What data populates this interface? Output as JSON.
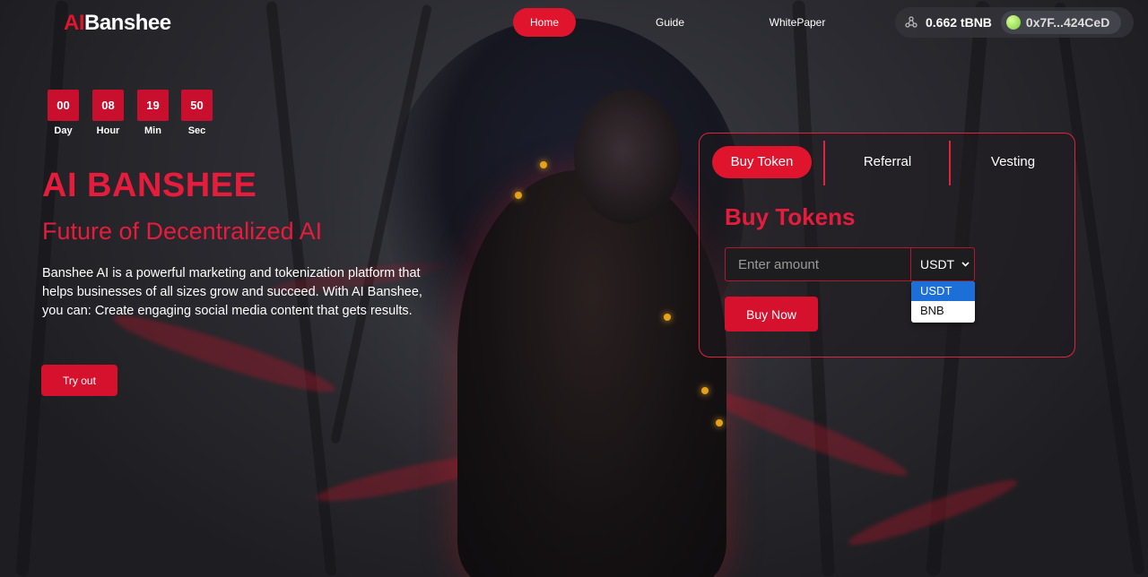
{
  "header": {
    "logo_ai": "AI",
    "logo_rest": "Banshee",
    "nav": {
      "home": "Home",
      "guide": "Guide",
      "whitepaper": "WhitePaper"
    },
    "wallet": {
      "network_icon": "network-icon",
      "balance": "0.662 tBNB",
      "address": "0x7F...424CeD"
    }
  },
  "countdown": {
    "day_value": "00",
    "day_label": "Day",
    "hour_value": "08",
    "hour_label": "Hour",
    "min_value": "19",
    "min_label": "Min",
    "sec_value": "50",
    "sec_label": "Sec"
  },
  "hero": {
    "title": "AI BANSHEE",
    "subtitle": "Future of Decentralized AI",
    "description": "Banshee AI is a powerful marketing and tokenization platform that helps businesses of all sizes grow and succeed. With AI Banshee, you can: Create engaging social media content that gets results.",
    "try_button": "Try out"
  },
  "panel": {
    "tabs": {
      "buy_token": "Buy Token",
      "referral": "Referral",
      "vesting": "Vesting"
    },
    "title": "Buy Tokens",
    "amount_placeholder": "Enter amount",
    "currency_selected": "USDT",
    "currency_options": [
      "USDT",
      "BNB"
    ],
    "buy_button": "Buy Now"
  },
  "colors": {
    "accent": "#e0142d",
    "title_red": "#e61c3d",
    "dropdown_highlight": "#1c6fd6"
  }
}
